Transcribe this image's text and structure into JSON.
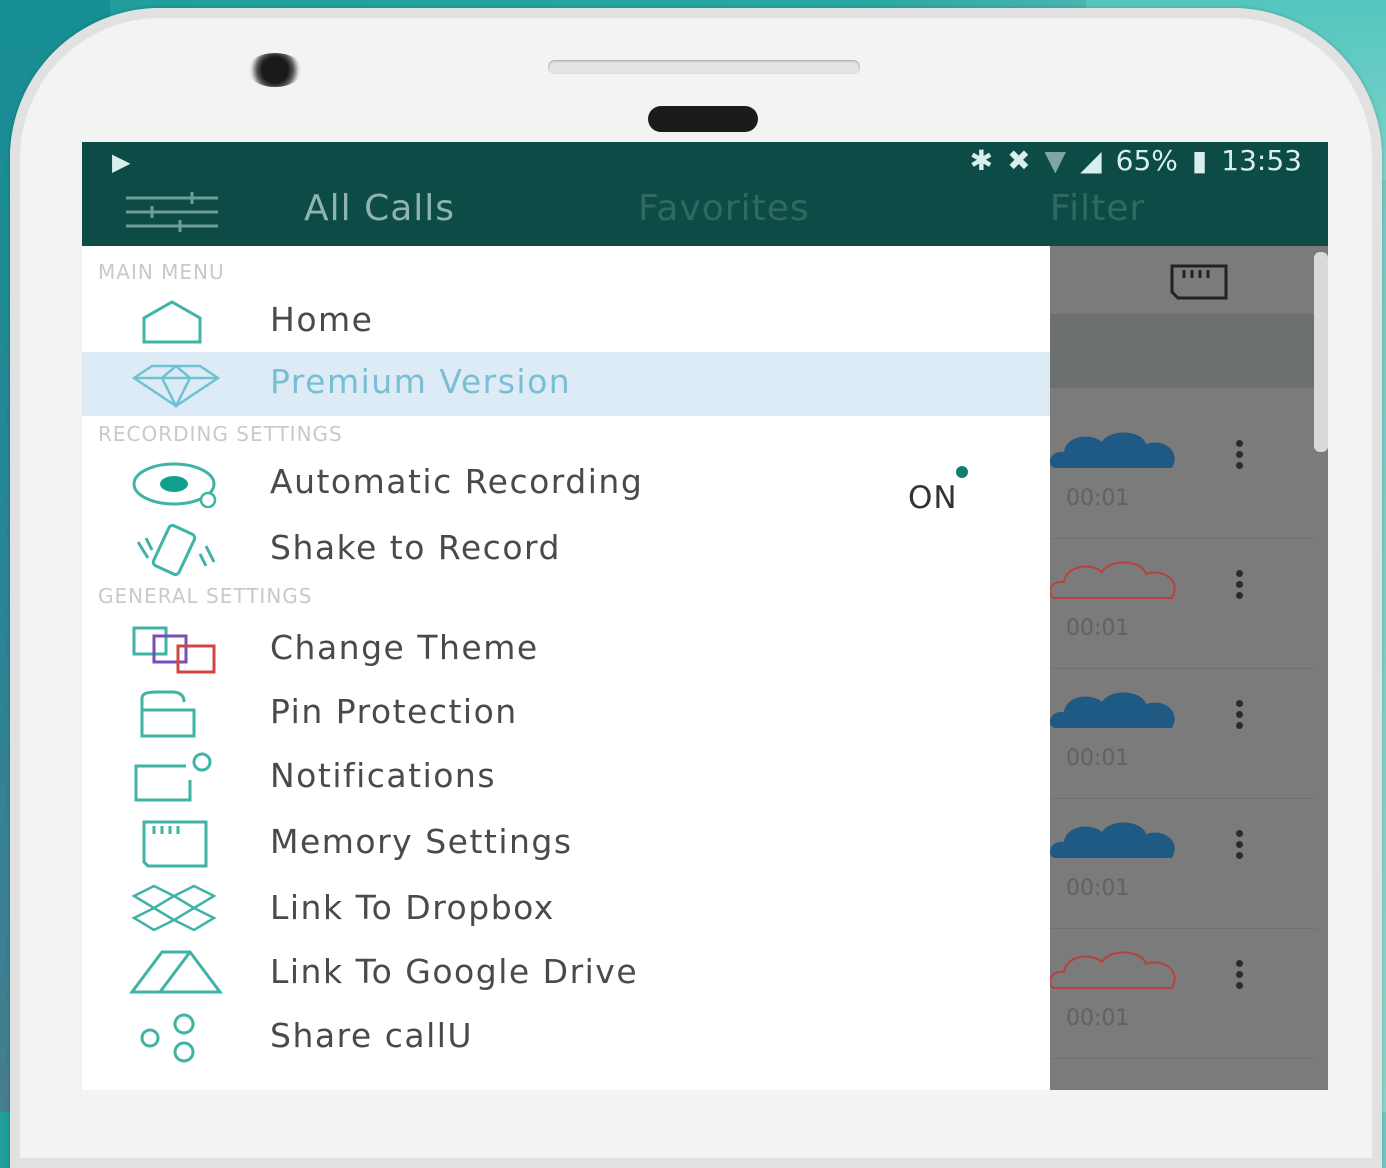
{
  "status_bar": {
    "left_icon": "play-store-icon",
    "icons": [
      "bluetooth-icon",
      "mute-icon",
      "wifi-icon",
      "signal-icon"
    ],
    "battery": "65%",
    "time": "13:53"
  },
  "tabs": [
    {
      "label": "All Calls"
    },
    {
      "label": "Favorites"
    },
    {
      "label": "Filter"
    }
  ],
  "drawer": {
    "sections": {
      "main": "MAIN MENU",
      "recording": "RECORDING SETTINGS",
      "general": "GENERAL SETTINGS"
    },
    "items": {
      "home": {
        "label": "Home",
        "icon": "home-icon"
      },
      "premium": {
        "label": "Premium Version",
        "icon": "diamond-icon"
      },
      "auto_record": {
        "label": "Automatic Recording",
        "icon": "record-icon",
        "toggle": "ON"
      },
      "shake": {
        "label": "Shake to Record",
        "icon": "shake-phone-icon"
      },
      "theme": {
        "label": "Change Theme",
        "icon": "theme-icon"
      },
      "pin": {
        "label": "Pin Protection",
        "icon": "lock-icon"
      },
      "notifications": {
        "label": "Notifications",
        "icon": "notification-icon"
      },
      "memory": {
        "label": "Memory Settings",
        "icon": "sd-card-icon"
      },
      "dropbox": {
        "label": "Link To Dropbox",
        "icon": "dropbox-icon"
      },
      "drive": {
        "label": "Link To Google Drive",
        "icon": "google-drive-icon"
      },
      "share": {
        "label": "Share callU",
        "icon": "share-icon"
      }
    }
  },
  "background_list": {
    "rows": [
      {
        "duration": "00:01",
        "cloud": "filled"
      },
      {
        "duration": "00:01",
        "cloud": "outline"
      },
      {
        "duration": "00:01",
        "cloud": "filled"
      },
      {
        "duration": "00:01",
        "cloud": "filled"
      },
      {
        "duration": "00:01",
        "cloud": "outline"
      }
    ]
  },
  "colors": {
    "appbar": "#0d4c46",
    "accent": "#3fb3a6",
    "highlight": "#dcebf6",
    "cloud_filled": "#1f5a85",
    "cloud_outline": "#b8413d"
  }
}
